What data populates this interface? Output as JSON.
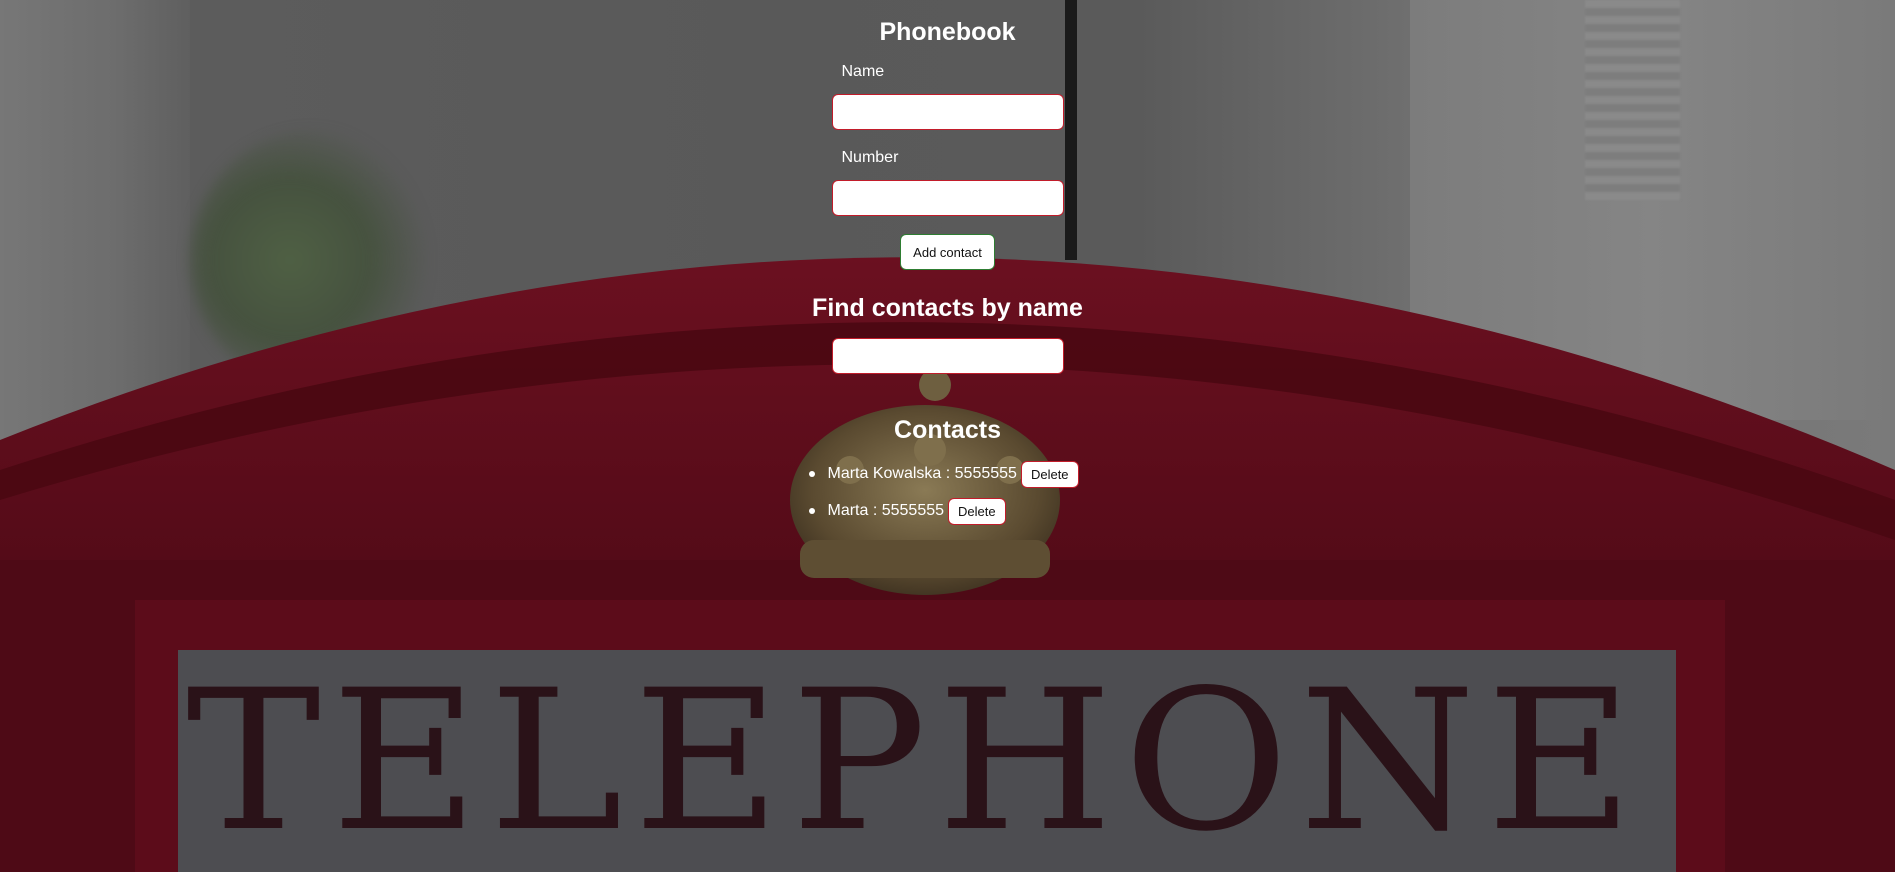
{
  "app": {
    "title": "Phonebook"
  },
  "form": {
    "name_label": "Name",
    "name_value": "",
    "number_label": "Number",
    "number_value": "",
    "add_button": "Add contact"
  },
  "filter": {
    "title": "Find contacts by name",
    "value": ""
  },
  "contacts": {
    "title": "Contacts",
    "items": [
      {
        "name": "Marta Kowalska",
        "number": "5555555",
        "text": "Marta Kowalska : 5555555",
        "delete_label": "Delete"
      },
      {
        "name": "Marta",
        "number": "5555555",
        "text": "Marta : 5555555",
        "delete_label": "Delete"
      }
    ]
  },
  "background": {
    "sign_text": "TELEPHONE"
  },
  "colors": {
    "input_border": "#c21c2a",
    "add_button_border": "#2e7d32",
    "text": "#ffffff",
    "telephone_box": "#5a0f1c"
  }
}
